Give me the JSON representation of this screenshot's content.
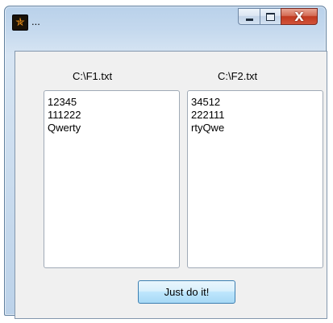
{
  "window": {
    "title": "...",
    "icon": "star-icon",
    "caption": {
      "minimize_icon": "minimize-icon",
      "maximize_icon": "maximize-icon",
      "close_glyph": "X"
    }
  },
  "left": {
    "label": "C:\\F1.txt",
    "items": [
      "12345",
      "111222",
      "Qwerty"
    ]
  },
  "right": {
    "label": "C:\\F2.txt",
    "items": [
      "34512",
      "222111",
      "rtyQwe"
    ]
  },
  "action": {
    "button_label": "Just do it!"
  },
  "colors": {
    "close_button": "#c0391f",
    "app_icon_glyph": "#ff9a1a"
  }
}
